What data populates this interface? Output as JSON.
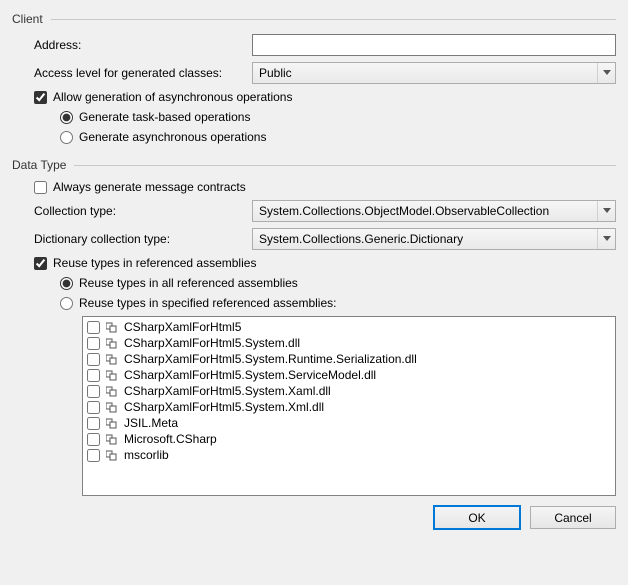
{
  "groups": {
    "client": "Client",
    "datatype": "Data Type"
  },
  "labels": {
    "address": "Address:",
    "access_level": "Access level for generated classes:",
    "allow_async": "Allow generation of asynchronous operations",
    "gen_task": "Generate task-based operations",
    "gen_async": "Generate asynchronous operations",
    "always_msg_contracts": "Always generate message contracts",
    "collection_type": "Collection type:",
    "dictionary_type": "Dictionary collection type:",
    "reuse_types": "Reuse types in referenced assemblies",
    "reuse_all": "Reuse types in all referenced assemblies",
    "reuse_specified": "Reuse types in specified referenced assemblies:"
  },
  "values": {
    "address": "",
    "access_level": "Public",
    "collection_type": "System.Collections.ObjectModel.ObservableCollection",
    "dictionary_type": "System.Collections.Generic.Dictionary"
  },
  "checks": {
    "allow_async": true,
    "always_msg_contracts": false,
    "reuse_types": true
  },
  "radios": {
    "async_mode": "task",
    "reuse_mode": "all"
  },
  "assemblies": [
    "CSharpXamlForHtml5",
    "CSharpXamlForHtml5.System.dll",
    "CSharpXamlForHtml5.System.Runtime.Serialization.dll",
    "CSharpXamlForHtml5.System.ServiceModel.dll",
    "CSharpXamlForHtml5.System.Xaml.dll",
    "CSharpXamlForHtml5.System.Xml.dll",
    "JSIL.Meta",
    "Microsoft.CSharp",
    "mscorlib"
  ],
  "buttons": {
    "ok": "OK",
    "cancel": "Cancel"
  }
}
